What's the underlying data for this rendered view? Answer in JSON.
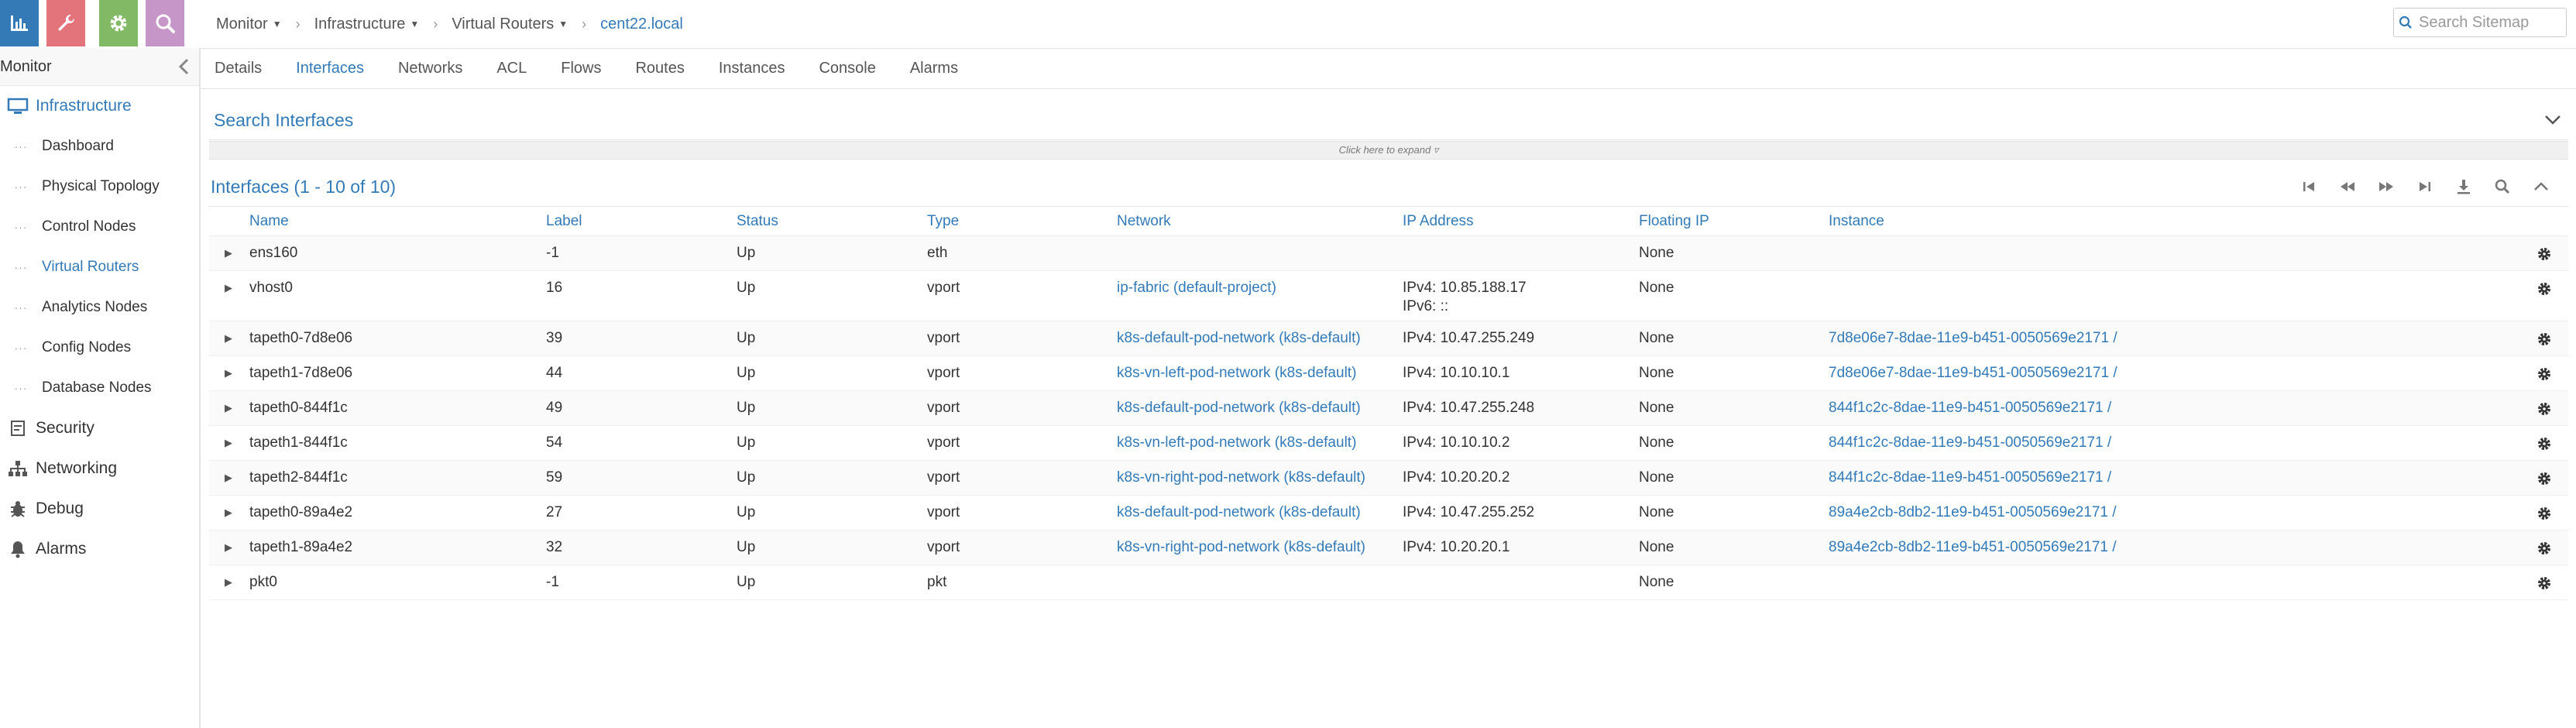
{
  "top_buttons": [
    {
      "name": "monitor",
      "color": "#337ab7"
    },
    {
      "name": "configure",
      "color": "#e3747c"
    },
    {
      "name": "settings",
      "color": "#81b965"
    },
    {
      "name": "query",
      "color": "#c596c7"
    }
  ],
  "sidebar": {
    "title": "Monitor",
    "sections": [
      {
        "label": "Infrastructure",
        "icon": "monitor-icon",
        "active": true
      },
      {
        "label": "Security",
        "icon": "security-icon"
      },
      {
        "label": "Networking",
        "icon": "networking-icon"
      },
      {
        "label": "Debug",
        "icon": "debug-icon"
      },
      {
        "label": "Alarms",
        "icon": "bell-icon"
      }
    ],
    "sub_items": [
      "Dashboard",
      "Physical Topology",
      "Control Nodes",
      "Virtual Routers",
      "Analytics Nodes",
      "Config Nodes",
      "Database Nodes"
    ]
  },
  "breadcrumb": {
    "items": [
      "Monitor",
      "Infrastructure",
      "Virtual Routers"
    ],
    "current": "cent22.local"
  },
  "search": {
    "placeholder": "Search Sitemap"
  },
  "tabs": [
    "Details",
    "Interfaces",
    "Networks",
    "ACL",
    "Flows",
    "Routes",
    "Instances",
    "Console",
    "Alarms"
  ],
  "active_tab": "Interfaces",
  "search_panel": {
    "title": "Search Interfaces",
    "expand_hint": "Click here to expand ▿"
  },
  "grid": {
    "title": "Interfaces (1 - 10 of 10)",
    "columns": [
      "Name",
      "Label",
      "Status",
      "Type",
      "Network",
      "IP Address",
      "Floating IP",
      "Instance"
    ],
    "rows": [
      {
        "name": "ens160",
        "label": "-1",
        "status": "Up",
        "type": "eth",
        "network": "",
        "ip": [
          "",
          ""
        ],
        "floating": "None",
        "instance": ""
      },
      {
        "name": "vhost0",
        "label": "16",
        "status": "Up",
        "type": "vport",
        "network": "ip-fabric (default-project)",
        "ip": [
          "IPv4: 10.85.188.17",
          "IPv6: ::"
        ],
        "floating": "None",
        "instance": ""
      },
      {
        "name": "tapeth0-7d8e06",
        "label": "39",
        "status": "Up",
        "type": "vport",
        "network": "k8s-default-pod-network (k8s-default)",
        "ip": [
          "IPv4: 10.47.255.249",
          ""
        ],
        "floating": "None",
        "instance": "7d8e06e7-8dae-11e9-b451-0050569e2171 /"
      },
      {
        "name": "tapeth1-7d8e06",
        "label": "44",
        "status": "Up",
        "type": "vport",
        "network": "k8s-vn-left-pod-network (k8s-default)",
        "ip": [
          "IPv4: 10.10.10.1",
          ""
        ],
        "floating": "None",
        "instance": "7d8e06e7-8dae-11e9-b451-0050569e2171 /"
      },
      {
        "name": "tapeth0-844f1c",
        "label": "49",
        "status": "Up",
        "type": "vport",
        "network": "k8s-default-pod-network (k8s-default)",
        "ip": [
          "IPv4: 10.47.255.248",
          ""
        ],
        "floating": "None",
        "instance": "844f1c2c-8dae-11e9-b451-0050569e2171 /"
      },
      {
        "name": "tapeth1-844f1c",
        "label": "54",
        "status": "Up",
        "type": "vport",
        "network": "k8s-vn-left-pod-network (k8s-default)",
        "ip": [
          "IPv4: 10.10.10.2",
          ""
        ],
        "floating": "None",
        "instance": "844f1c2c-8dae-11e9-b451-0050569e2171 /"
      },
      {
        "name": "tapeth2-844f1c",
        "label": "59",
        "status": "Up",
        "type": "vport",
        "network": "k8s-vn-right-pod-network (k8s-default)",
        "ip": [
          "IPv4: 10.20.20.2",
          ""
        ],
        "floating": "None",
        "instance": "844f1c2c-8dae-11e9-b451-0050569e2171 /"
      },
      {
        "name": "tapeth0-89a4e2",
        "label": "27",
        "status": "Up",
        "type": "vport",
        "network": "k8s-default-pod-network (k8s-default)",
        "ip": [
          "IPv4: 10.47.255.252",
          ""
        ],
        "floating": "None",
        "instance": "89a4e2cb-8db2-11e9-b451-0050569e2171 /"
      },
      {
        "name": "tapeth1-89a4e2",
        "label": "32",
        "status": "Up",
        "type": "vport",
        "network": "k8s-vn-right-pod-network (k8s-default)",
        "ip": [
          "IPv4: 10.20.20.1",
          ""
        ],
        "floating": "None",
        "instance": "89a4e2cb-8db2-11e9-b451-0050569e2171 /"
      },
      {
        "name": "pkt0",
        "label": "-1",
        "status": "Up",
        "type": "pkt",
        "network": "",
        "ip": [
          "",
          ""
        ],
        "floating": "None",
        "instance": ""
      }
    ]
  },
  "colors": {
    "link": "#337ab7",
    "text": "#333333"
  }
}
